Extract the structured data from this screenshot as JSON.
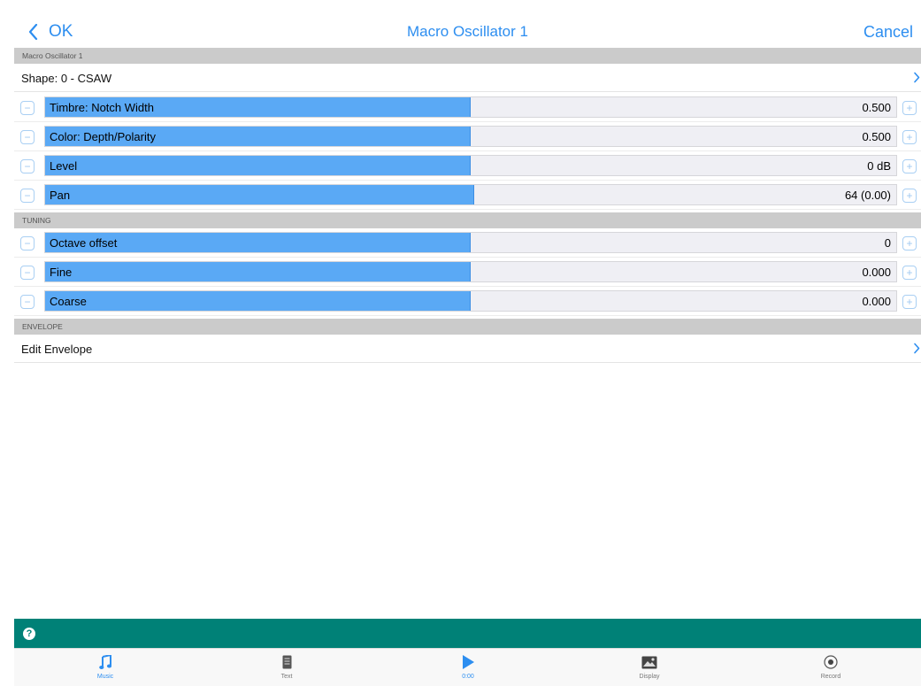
{
  "nav": {
    "back_label": "OK",
    "title": "Macro Oscillator 1",
    "cancel_label": "Cancel"
  },
  "sections": {
    "osc_header": "Macro Oscillator 1",
    "tuning_header": "TUNING",
    "envelope_header": "ENVELOPE"
  },
  "shape_row": {
    "label": "Shape: 0 - CSAW"
  },
  "sliders": [
    {
      "label": "Timbre: Notch Width",
      "value": "0.500",
      "fraction": 0.5
    },
    {
      "label": "Color: Depth/Polarity",
      "value": "0.500",
      "fraction": 0.5
    },
    {
      "label": "Level",
      "value": "0 dB",
      "fraction": 0.5
    },
    {
      "label": "Pan",
      "value": "64 (0.00)",
      "fraction": 0.504
    }
  ],
  "tuning_sliders": [
    {
      "label": "Octave offset",
      "value": "0",
      "fraction": 0.5
    },
    {
      "label": "Fine",
      "value": "0.000",
      "fraction": 0.5
    },
    {
      "label": "Coarse",
      "value": "0.000",
      "fraction": 0.5
    }
  ],
  "envelope_row": {
    "label": "Edit Envelope"
  },
  "help": {
    "icon_glyph": "?"
  },
  "tabs": [
    {
      "label": "Music",
      "icon": "music-note-icon"
    },
    {
      "label": "Text",
      "icon": "text-document-icon"
    },
    {
      "label": "0:00",
      "icon": "play-icon"
    },
    {
      "label": "Display",
      "icon": "image-icon"
    },
    {
      "label": "Record",
      "icon": "record-icon"
    }
  ],
  "colors": {
    "accent": "#2d8ef0",
    "slider_fill": "#5aa9f5",
    "help_bar": "#008177",
    "section_header": "#cbcbcb"
  }
}
